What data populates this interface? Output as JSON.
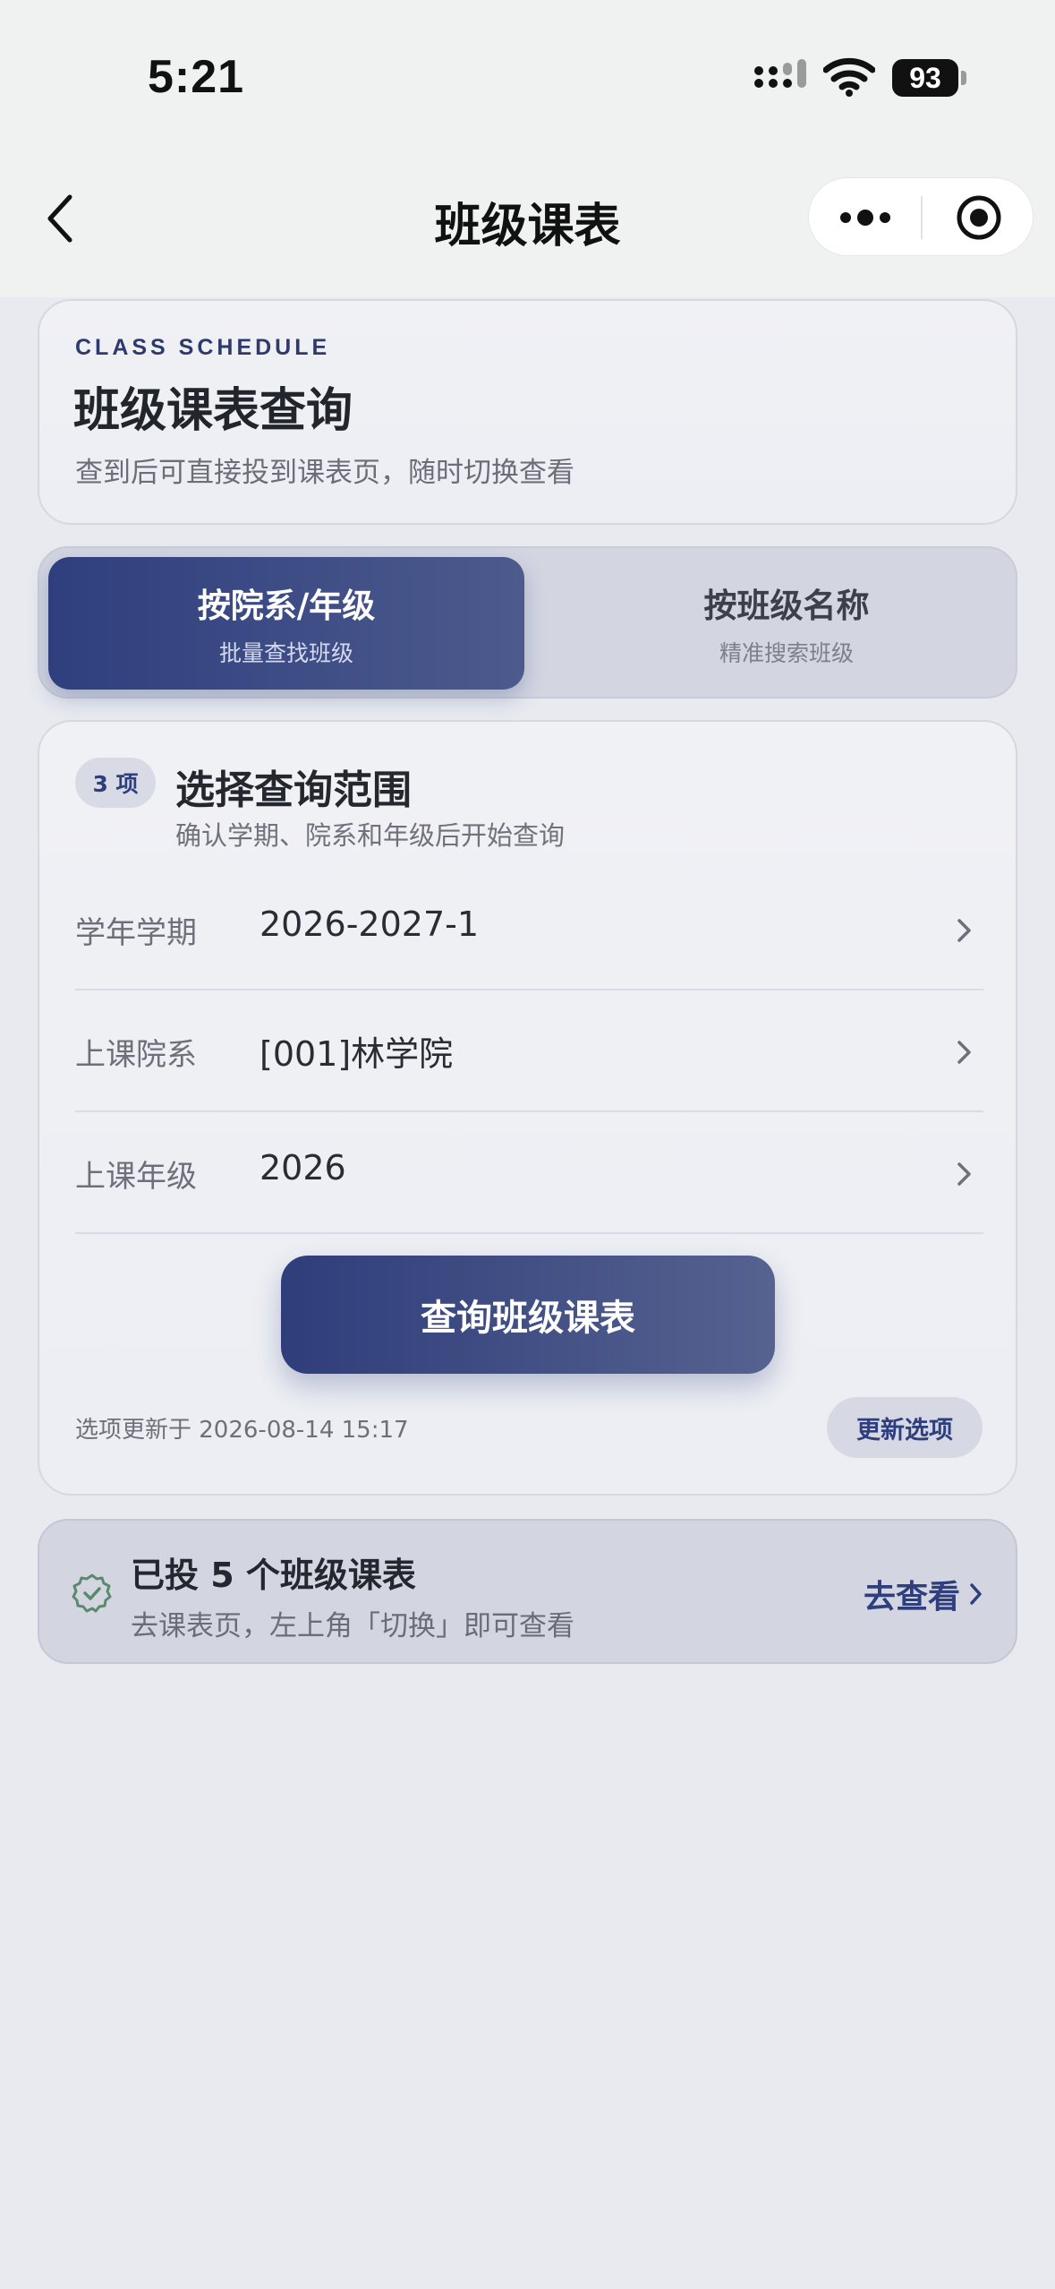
{
  "status_bar": {
    "time": "5:21",
    "battery": "93"
  },
  "nav": {
    "title": "班级课表",
    "icons": [
      "back-icon",
      "more-icon",
      "close-target-icon"
    ]
  },
  "hero": {
    "eyebrow": "CLASS SCHEDULE",
    "title": "班级课表查询",
    "subtitle": "查到后可直接投到课表页，随时切换查看"
  },
  "segment": {
    "tabs": [
      {
        "label": "按院系/年级",
        "sub": "批量查找班级",
        "active": true
      },
      {
        "label": "按班级名称",
        "sub": "精准搜索班级",
        "active": false
      }
    ]
  },
  "query": {
    "badge": "3 项",
    "title": "选择查询范围",
    "subtitle": "确认学期、院系和年级后开始查询",
    "rows": [
      {
        "label": "学年学期",
        "value": "2026-2027-1"
      },
      {
        "label": "上课院系",
        "value": "[001]林学院"
      },
      {
        "label": "上课年级",
        "value": "2026"
      }
    ],
    "button": "查询班级课表",
    "updated_text": "选项更新于 2026-08-14 15:17",
    "refresh_button": "更新选项"
  },
  "notice": {
    "title": "已投 5 个班级课表",
    "subtitle": "去课表页，左上角「切换」即可查看",
    "link": "去查看",
    "link_icon": "chevron-right-icon"
  },
  "colors": {
    "accent": "#2f3f7e",
    "background": "#e8eaf0",
    "topbar": "#eff2f1"
  }
}
